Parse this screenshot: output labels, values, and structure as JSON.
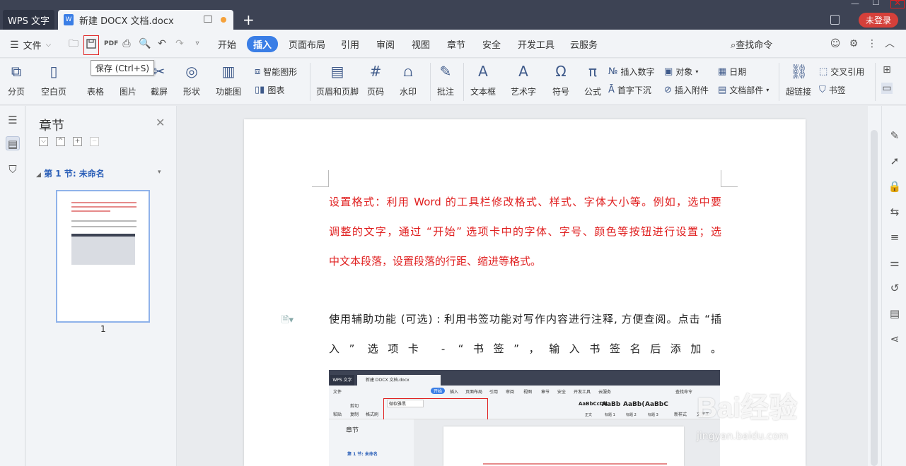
{
  "titlebar": {
    "app_tab": "WPS 文字",
    "doc_tab": "新建 DOCX 文档.docx",
    "login": "未登录",
    "add_tab": "+"
  },
  "menubar": {
    "file": "文件",
    "tabs": [
      "开始",
      "插入",
      "页面布局",
      "引用",
      "审阅",
      "视图",
      "章节",
      "安全",
      "开发工具",
      "云服务"
    ],
    "active_tab": "插入",
    "search": "查找命令"
  },
  "tooltip": "保存 (Ctrl+S)",
  "ribbon": {
    "big": [
      "分页",
      "空白页",
      "表格",
      "图片",
      "截屏",
      "形状",
      "功能图",
      "页眉和页脚",
      "页码",
      "水印",
      "批注",
      "文本框",
      "艺术字",
      "符号",
      "公式",
      "超链接"
    ],
    "small": {
      "smart_shape": "智能图形",
      "chart": "图表",
      "insert_number": "插入数字",
      "object": "对象",
      "date": "日期",
      "cross_ref": "交叉引用",
      "drop_cap": "首字下沉",
      "attachment": "插入附件",
      "doc_part": "文档部件",
      "bookmark": "书签"
    }
  },
  "panel": {
    "title": "章节",
    "section": "第 1 节: 未命名",
    "page_number": "1"
  },
  "document": {
    "para1_lines": [
      "设置格式：利用 Word 的工具栏修改格式、样式、字体大小等。例如，选中要",
      "调整的文字，通过 “开始” 选项卡中的字体、字号、颜色等按钮进行设置；选",
      "中文本段落，设置段落的行距、缩进等格式。"
    ],
    "para2_lines": [
      "使用辅助功能 (可选) : 利用书签功能对写作内容进行注释, 方便查阅。点击 “插",
      "入” 选项卡 - “书签”，输入书签名后添加。"
    ]
  },
  "embedded": {
    "app_tab": "WPS 文字",
    "doc_tab": "新建 DOCX 文档.docx",
    "file": "文件",
    "tabs": [
      "开始",
      "插入",
      "页面布局",
      "引用",
      "审阅",
      "视图",
      "章节",
      "安全",
      "开发工具",
      "云服务"
    ],
    "search": "查找命令",
    "font": "微软雅黑",
    "styles": [
      "AaBbCcDd",
      "AaBb",
      "AaBb(",
      "AaBbC"
    ],
    "style_names": [
      "正文",
      "标题 1",
      "标题 2",
      "标题 3"
    ],
    "panel_title": "章节",
    "section": "第 1 节: 未命名",
    "paste": "粘贴",
    "cut": "剪切",
    "copy": "复制",
    "format_painter": "格式刷",
    "new_style": "新样式",
    "text_tools": "文字工"
  },
  "watermark": {
    "main": "Bai经验",
    "sub": "jingyan.baidu.com"
  },
  "colors": {
    "titlebar": "#3d4354",
    "accent": "#3a7ee6",
    "red_text": "#e02020",
    "login": "#d5403a"
  }
}
